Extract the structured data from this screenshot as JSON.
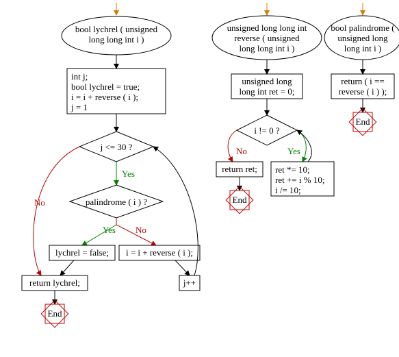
{
  "flowcharts": [
    {
      "name": "lychrel",
      "signature": "bool lychrel ( unsigned long long int i )",
      "init_block": "int j;\nbool lychrel = true;\ni = i + reverse ( i );\nj = 1",
      "loop_cond": "j <= 30 ?",
      "inner_cond": "palindrome ( i ) ?",
      "yes_branch_stmt": "lychrel = false;",
      "no_branch_stmt": "i = i + reverse ( i );",
      "increment": "j++",
      "return_stmt": "return lychrel;",
      "end_label": "End"
    },
    {
      "name": "reverse",
      "signature": "unsigned long long int reverse ( unsigned long long int i )",
      "init_block": "unsigned long long int ret = 0;",
      "loop_cond": "i != 0 ?",
      "body_stmt": "ret *= 10;\nret += i % 10;\ni /= 10;",
      "return_stmt": "return ret;",
      "end_label": "End"
    },
    {
      "name": "palindrome",
      "signature": "bool palindrome ( unsigned long long int i )",
      "return_stmt": "return ( i == reverse ( i ) );",
      "end_label": "End"
    }
  ],
  "labels": {
    "yes": "Yes",
    "no": "No"
  }
}
